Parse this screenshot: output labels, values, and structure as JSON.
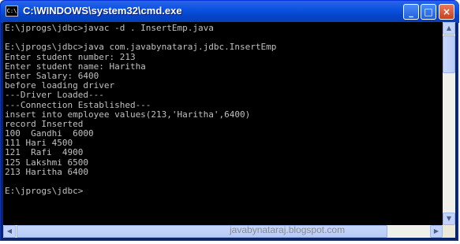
{
  "window": {
    "title": "C:\\WINDOWS\\system32\\cmd.exe",
    "icon": "cmd-icon",
    "icon_glyph": "C:\\"
  },
  "titlebar_buttons": {
    "minimize": "_",
    "maximize": "□",
    "close": "×"
  },
  "console": {
    "lines": [
      "E:\\jprogs\\jdbc>javac -d . InsertEmp.java",
      "",
      "E:\\jprogs\\jdbc>java com.javabynataraj.jdbc.InsertEmp",
      "Enter student number: 213",
      "Enter student name: Haritha",
      "Enter Salary: 6400",
      "before loading driver",
      "---Driver Loaded---",
      "---Connection Established---",
      "insert into employee values(213,'Haritha',6400)",
      "record Inserted",
      "100  Gandhi  6000",
      "111 Hari 4500",
      "121  Rafi  4900",
      "125 Lakshmi 6500",
      "213 Haritha 6400",
      "",
      "E:\\jprogs\\jdbc>"
    ]
  },
  "scrollbar": {
    "up": "▲",
    "down": "▼",
    "left": "◀",
    "right": "▶"
  },
  "watermark": "javabynataraj.blogspot.com"
}
